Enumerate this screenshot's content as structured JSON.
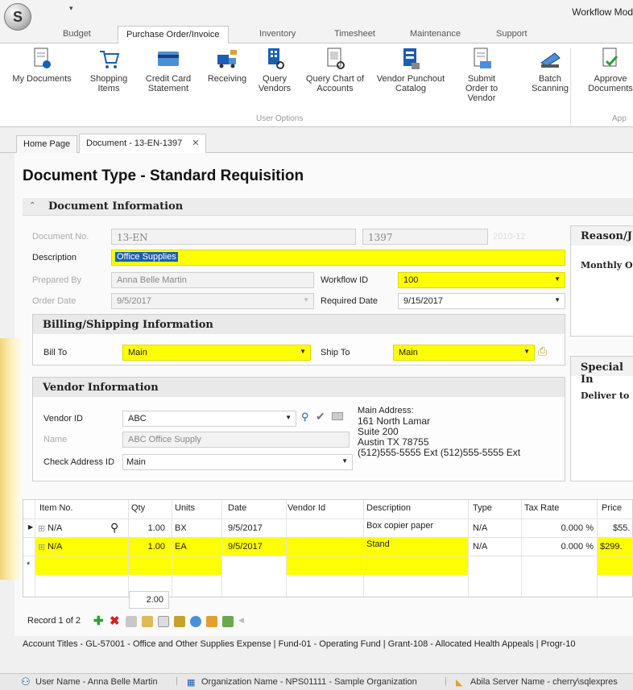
{
  "app": {
    "window_title": "Workflow Mod",
    "qat": "▾"
  },
  "ribbon_tabs": [
    "Budget",
    "Purchase Order/Invoice",
    "Inventory",
    "Timesheet",
    "Maintenance",
    "Support"
  ],
  "ribbon_buttons": [
    {
      "label": "My Documents",
      "icon": "my-documents-icon"
    },
    {
      "label": "Shopping Items",
      "icon": "shopping-cart-icon"
    },
    {
      "label": "Credit Card Statement",
      "icon": "credit-card-icon"
    },
    {
      "label": "Receiving",
      "icon": "receiving-truck-icon"
    },
    {
      "label": "Query Vendors",
      "icon": "query-vendors-icon"
    },
    {
      "label": "Query Chart of Accounts",
      "icon": "query-accounts-icon"
    },
    {
      "label": "Vendor Punchout Catalog",
      "icon": "punchout-catalog-icon"
    },
    {
      "label": "Submit Order to Vendor",
      "icon": "submit-order-icon"
    },
    {
      "label": "Batch Scanning",
      "icon": "scanner-icon"
    },
    {
      "label": "Approve Documents",
      "icon": "approve-icon"
    }
  ],
  "ribbon_group_label": "User Options",
  "ribbon_group_label2": "App",
  "doc_tabs": {
    "home": "Home Page",
    "document": "Document - 13-EN-1397",
    "close": "✕"
  },
  "page_title": "Document Type - Standard Requisition",
  "doc_info": {
    "header": "Document Information",
    "document_no_label": "Document No.",
    "document_no_prefix": "13-EN",
    "document_no_number": "1397",
    "document_no_faded": "2010-12",
    "description_label": "Description",
    "description_value": "Office Supplies",
    "prepared_by_label": "Prepared By",
    "prepared_by_value": "Anna Belle Martin",
    "workflow_id_label": "Workflow ID",
    "workflow_id_value": "100",
    "order_date_label": "Order Date",
    "order_date_value": "9/5/2017",
    "required_date_label": "Required Date",
    "required_date_value": "9/15/2017"
  },
  "billing": {
    "header": "Billing/Shipping Information",
    "bill_to_label": "Bill To",
    "bill_to_value": "Main",
    "ship_to_label": "Ship To",
    "ship_to_value": "Main"
  },
  "vendor": {
    "header": "Vendor Information",
    "vendor_id_label": "Vendor ID",
    "vendor_id_value": "ABC",
    "name_label": "Name",
    "name_value": "ABC Office Supply",
    "check_address_label": "Check Address ID",
    "check_address_value": "Main",
    "address_title": "Main Address:",
    "address_lines": [
      "161 North Lamar",
      "Suite 200",
      "Austin TX 78755",
      "(512)555-5555 Ext (512)555-5555 Ext"
    ]
  },
  "right_panels": {
    "reason_header": "Reason/J",
    "reason_text": "Monthly O",
    "special_header": "Special In",
    "special_text": "Deliver to"
  },
  "grid": {
    "columns": [
      "Item No.",
      "Qty",
      "Units",
      "Date",
      "Vendor Id",
      "Description",
      "Type",
      "Tax Rate",
      "Price"
    ],
    "rows": [
      {
        "item": "N/A",
        "qty": "1.00",
        "units": "BX",
        "date": "9/5/2017",
        "vendor_id": "",
        "description": "Box copier paper",
        "type": "N/A",
        "tax_rate": "0.000 %",
        "price": "$55."
      },
      {
        "item": "N/A",
        "qty": "1.00",
        "units": "EA",
        "date": "9/5/2017",
        "vendor_id": "",
        "description": "Stand",
        "type": "N/A",
        "tax_rate": "0.000 %",
        "price": "$299."
      }
    ],
    "new_row_marker": "*",
    "qty_total": "2.00"
  },
  "navigator": {
    "record_text": "Record 1 of 2"
  },
  "account_titles": "Account Titles - GL-57001 - Office and Other Supplies Expense | Fund-01 - Operating Fund | Grant-108 - Allocated Health Appeals | Progr-10",
  "status": {
    "user": "User Name - Anna Belle Martin",
    "org": "Organization Name - NPS01111 - Sample Organization",
    "server": "Abila Server Name - cherry\\sqlexpres"
  },
  "colors": {
    "highlight": "#ffff00",
    "accent": "#1a5fb4"
  }
}
